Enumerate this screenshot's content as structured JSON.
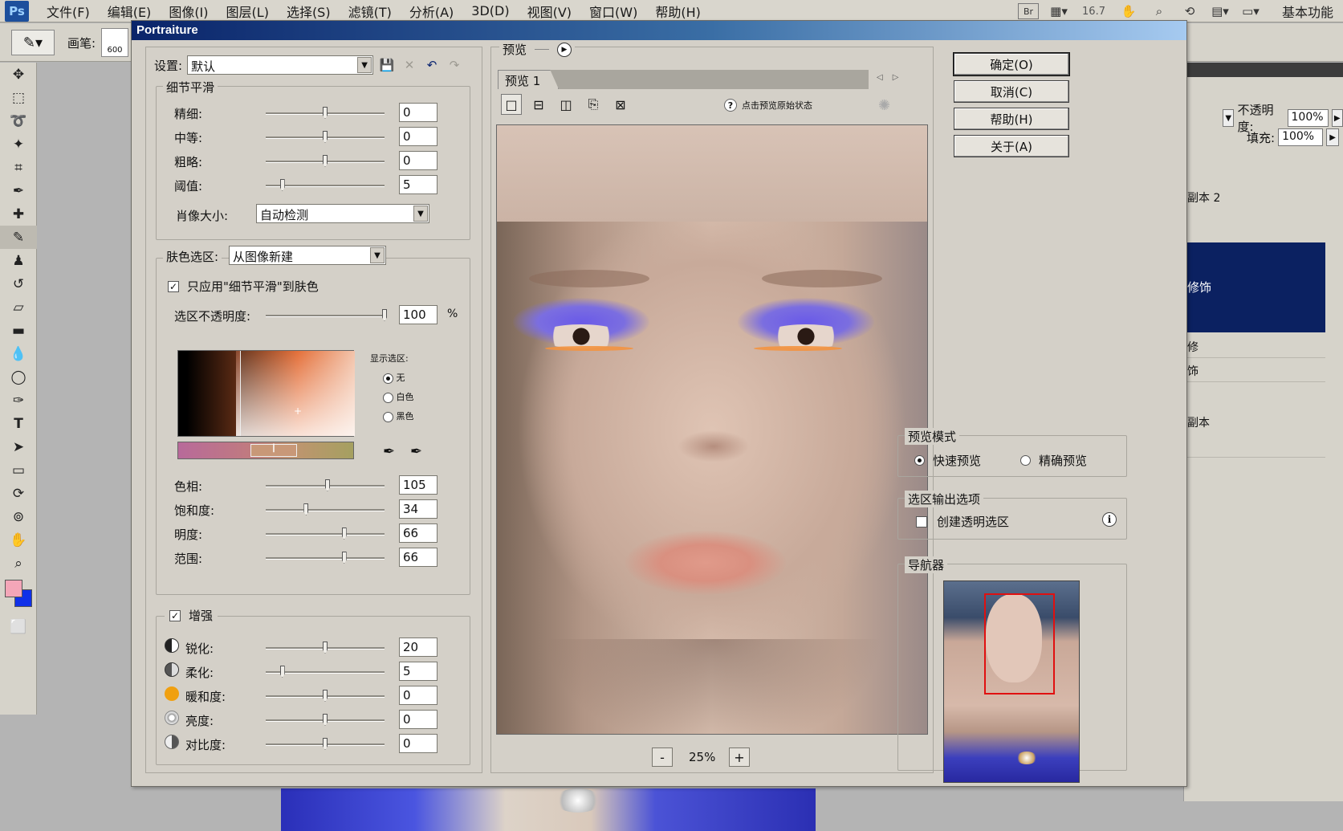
{
  "menubar": {
    "logo": "Ps",
    "items": [
      "文件(F)",
      "编辑(E)",
      "图像(I)",
      "图层(L)",
      "选择(S)",
      "滤镜(T)",
      "分析(A)",
      "3D(D)",
      "视图(V)",
      "窗口(W)",
      "帮助(H)"
    ],
    "bridge_label": "Br",
    "zoom": "16.7",
    "workspace": "基本功能"
  },
  "options": {
    "brush_label": "画笔:",
    "brush_size": "600"
  },
  "layers_panel": {
    "opacity_label": "不透明度:",
    "opacity_value": "100%",
    "fill_label": "填充:",
    "fill_value": "100%",
    "layers": [
      "副本 2",
      "修饰",
      "修",
      "饰",
      "副本"
    ]
  },
  "dialog": {
    "title": "Portraiture",
    "settings_label": "设置:",
    "settings_value": "默认",
    "detail_smoothing": {
      "title": "细节平滑",
      "rows": [
        {
          "label": "精细:",
          "value": "0",
          "pos": 0.5
        },
        {
          "label": "中等:",
          "value": "0",
          "pos": 0.5
        },
        {
          "label": "粗略:",
          "value": "0",
          "pos": 0.5
        },
        {
          "label": "阈值:",
          "value": "5",
          "pos": 0.14
        }
      ],
      "portrait_size_label": "肖像大小:",
      "portrait_size_value": "自动检测"
    },
    "skin_mask": {
      "label": "肤色选区:",
      "value": "从图像新建",
      "apply_label": "只应用\"细节平滑\"到肤色",
      "opacity_label": "选区不透明度:",
      "opacity_value": "100",
      "opacity_unit": "%",
      "show_label": "显示选区:",
      "show_options": [
        "无",
        "白色",
        "黑色"
      ],
      "rows": [
        {
          "label": "色相:",
          "value": "105",
          "pos": 0.52
        },
        {
          "label": "饱和度:",
          "value": "34",
          "pos": 0.34
        },
        {
          "label": "明度:",
          "value": "66",
          "pos": 0.66
        },
        {
          "label": "范围:",
          "value": "66",
          "pos": 0.66
        }
      ]
    },
    "enhancements": {
      "title": "增强",
      "rows": [
        {
          "label": "锐化:",
          "value": "20",
          "pos": 0.5,
          "icon": "sharpen-icon",
          "color": "#222222"
        },
        {
          "label": "柔化:",
          "value": "5",
          "pos": 0.14,
          "icon": "soften-icon",
          "color": "#444444"
        },
        {
          "label": "暖和度:",
          "value": "0",
          "pos": 0.5,
          "icon": "warmth-icon",
          "color": "#f0a010"
        },
        {
          "label": "亮度:",
          "value": "0",
          "pos": 0.5,
          "icon": "brightness-icon",
          "color": "#888888"
        },
        {
          "label": "对比度:",
          "value": "0",
          "pos": 0.5,
          "icon": "contrast-icon",
          "color": "#666666"
        }
      ]
    },
    "preview": {
      "label": "预览",
      "tab": "预览 1",
      "hint": "点击预览原始状态",
      "zoom": "25%",
      "zoom_out": "-",
      "zoom_in": "+"
    },
    "buttons": {
      "ok": "确定(O)",
      "cancel": "取消(C)",
      "help": "帮助(H)",
      "about": "关于(A)"
    },
    "preview_mode": {
      "title": "预览模式",
      "fast": "快速预览",
      "precise": "精确预览"
    },
    "mask_output": {
      "title": "选区输出选项",
      "transparent": "创建透明选区"
    },
    "navigator": {
      "title": "导航器"
    }
  }
}
